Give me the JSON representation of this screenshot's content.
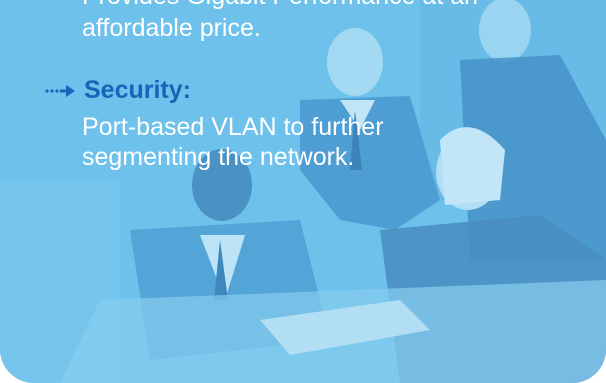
{
  "intro": {
    "line1": "Provides Gigabit Performance at an",
    "line2": "affordable price."
  },
  "feature": {
    "bullet_icon": "dotted-arrow-icon",
    "title": "Security:",
    "desc_line1": "Port-based VLAN to further",
    "desc_line2": "segmenting the network."
  },
  "colors": {
    "panel_blue": "#6cc0ec",
    "heading_blue": "#1565b8",
    "text_white": "#ffffff"
  }
}
